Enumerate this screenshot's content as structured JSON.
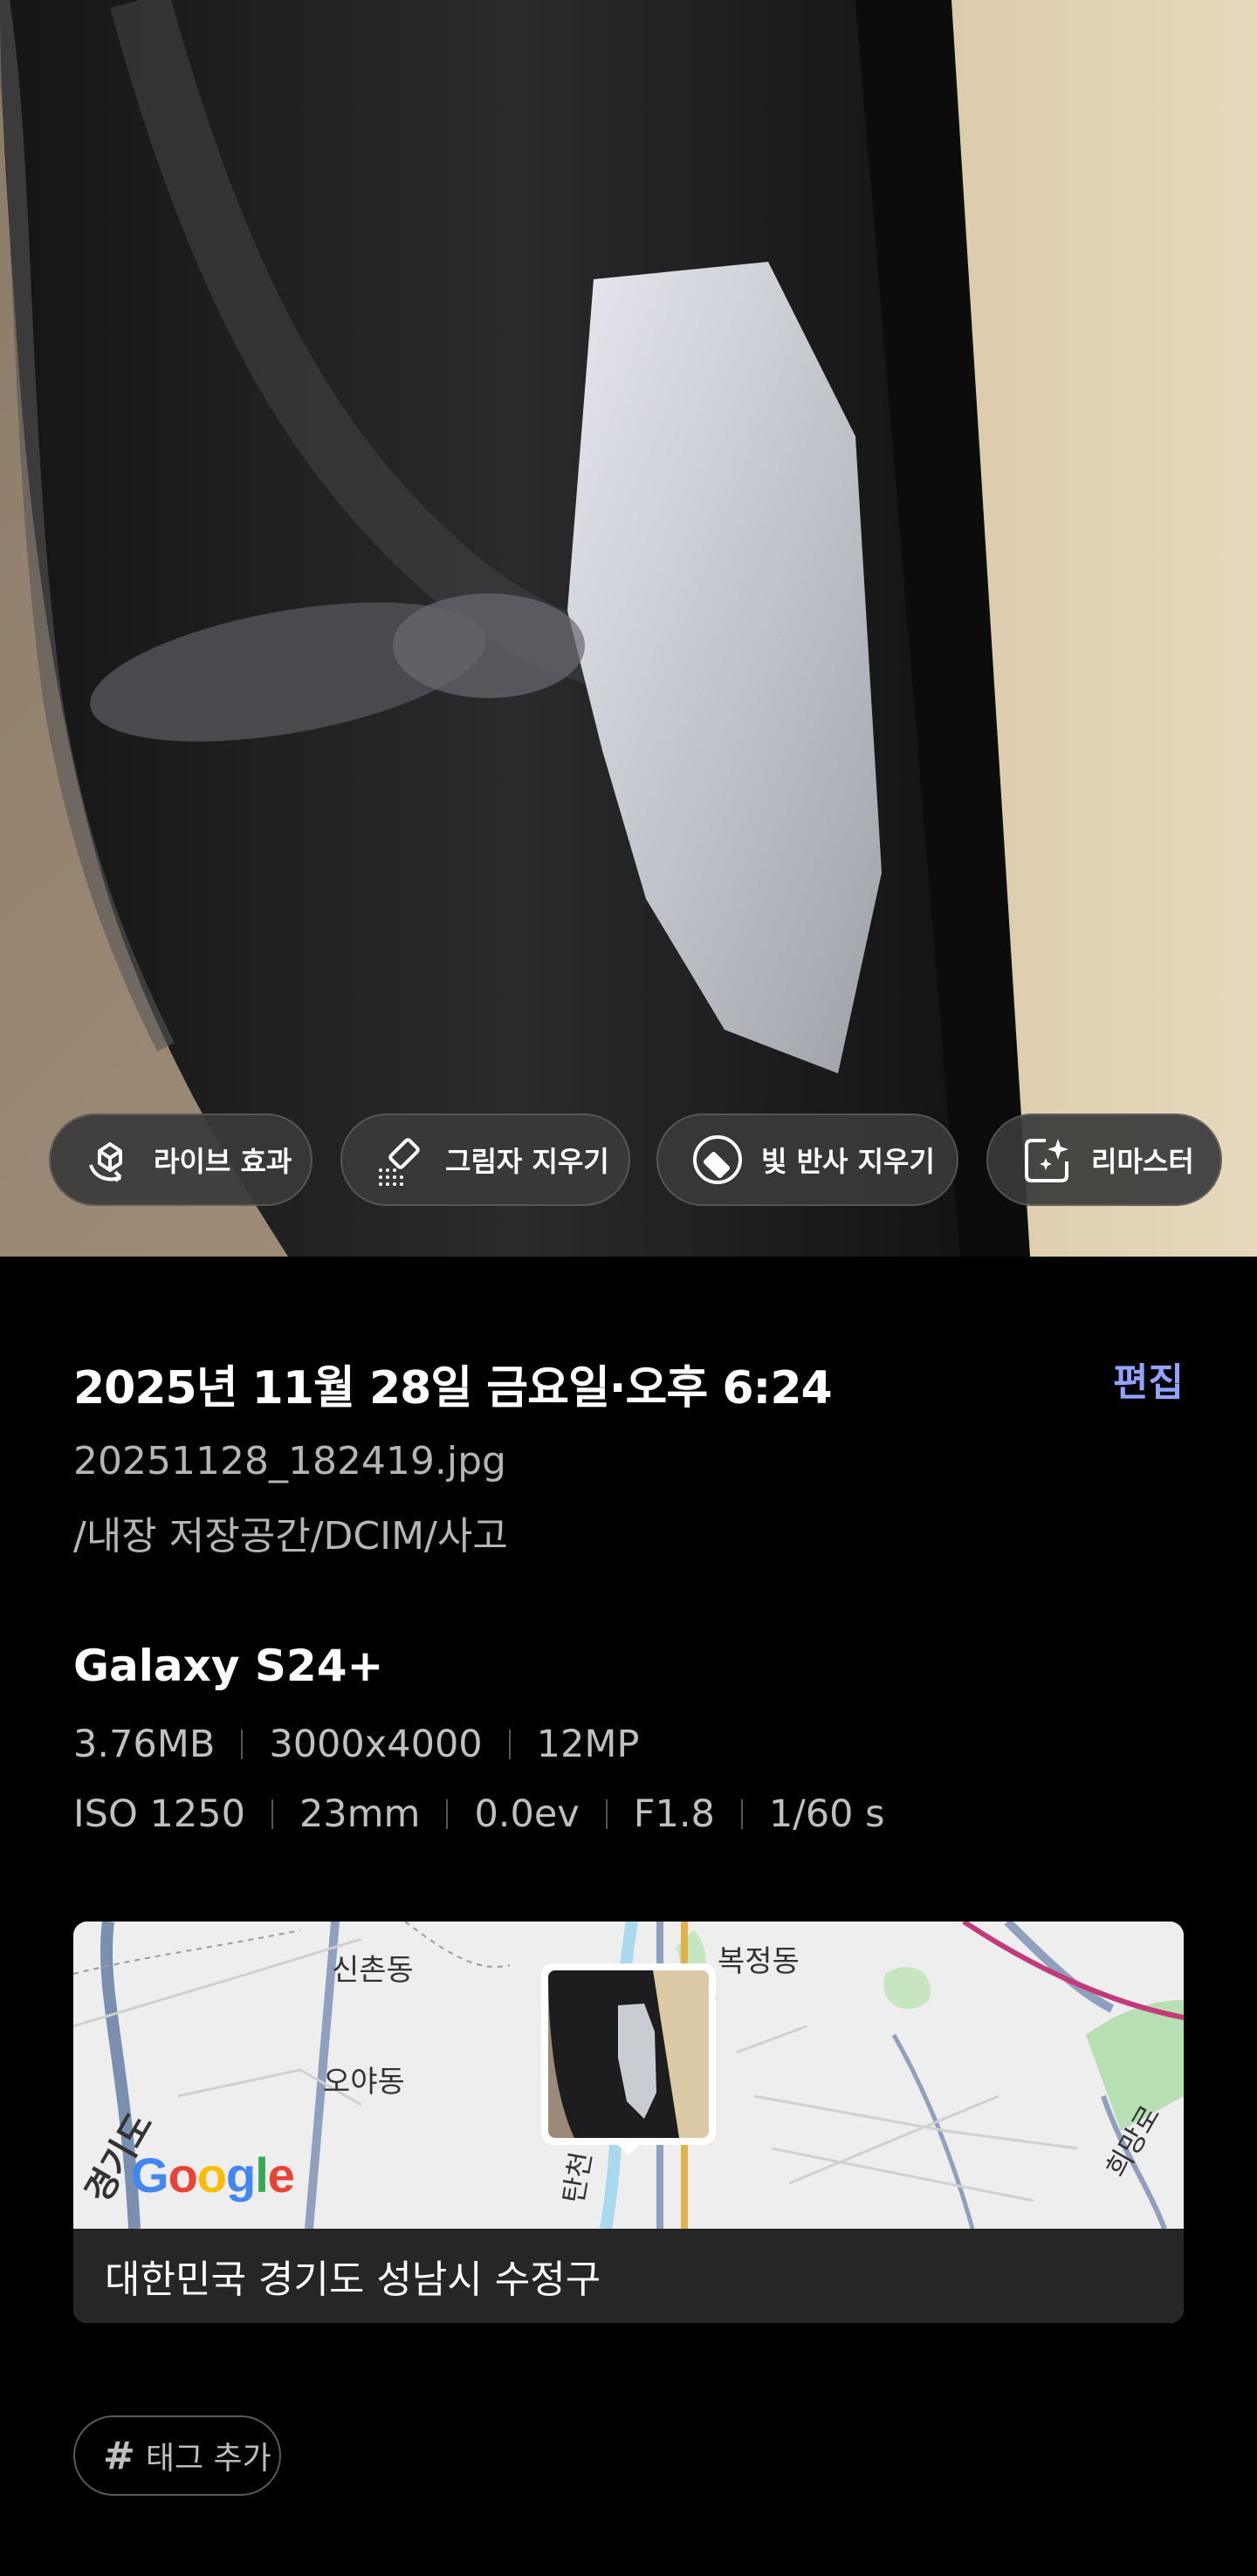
{
  "photo_actions": [
    {
      "label": "라이브 효과",
      "icon": "live-effect-icon"
    },
    {
      "label": "그림자 지우기",
      "icon": "shadow-eraser-icon"
    },
    {
      "label": "빛 반사 지우기",
      "icon": "reflection-eraser-icon"
    },
    {
      "label": "리마스터",
      "icon": "remaster-icon"
    }
  ],
  "details": {
    "datetime": "2025년 11월 28일 금요일·오후 6:24",
    "edit_label": "편집",
    "filename": "20251128_182419.jpg",
    "path": "/내장 저장공간/DCIM/사고",
    "device": "Galaxy S24+",
    "file_specs": [
      "3.76MB",
      "3000x4000",
      "12MP"
    ],
    "camera_specs": [
      "ISO 1250",
      "23mm",
      "0.0ev",
      "F1.8",
      "1/60 s"
    ]
  },
  "map": {
    "labels": [
      "신촌동",
      "복정동",
      "오야동",
      "경기도",
      "탄천",
      "희망로"
    ],
    "attribution": "Google",
    "address": "대한민국 경기도 성남시 수정구"
  },
  "tag": {
    "label": "태그 추가"
  },
  "colors": {
    "accent": "#8fa3ff",
    "background": "#000000",
    "chip": "#3a3a3a"
  }
}
